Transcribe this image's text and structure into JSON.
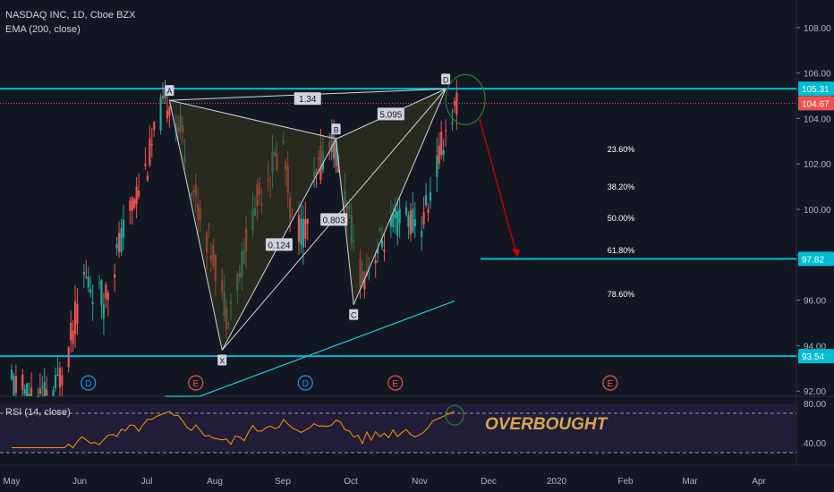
{
  "header": {
    "title": "NASDAQ INC, 1D, Cboe BZX",
    "indicator": "EMA (200, close)"
  },
  "colors": {
    "background": "#131722",
    "up": "#26a69a",
    "down": "#ef5350",
    "cyan": "#00bcd4",
    "ema": "#26c6da",
    "rsi": "#ff9800",
    "pattern_fill": "#3a3a1e",
    "arrow": "#d50000"
  },
  "chart_data": {
    "type": "candlestick",
    "title": "NASDAQ INC, 1D, Cboe BZX",
    "xlabel": "",
    "ylabel": "",
    "ylim": [
      91.5,
      108.8
    ],
    "y_ticks": [
      "108.00",
      "106.00",
      "104.00",
      "102.00",
      "100.00",
      "98.00",
      "96.00",
      "94.00",
      "92.00"
    ],
    "x_ticks": [
      "May",
      "Jun",
      "Jul",
      "Aug",
      "Sep",
      "Oct",
      "Nov",
      "Dec",
      "2020",
      "Feb",
      "Mar",
      "Apr"
    ],
    "price_labels": [
      {
        "text": "105.31",
        "value": 105.31,
        "style": "cyan"
      },
      {
        "text": "104.67",
        "value": 104.67,
        "style": "red"
      },
      {
        "text": "97.82",
        "value": 97.82,
        "style": "cyan"
      },
      {
        "text": "93.54",
        "value": 93.54,
        "style": "cyan"
      }
    ],
    "horizontal_lines": [
      105.31,
      97.82,
      93.54
    ],
    "harmonic_pattern": {
      "points": [
        {
          "label": "X",
          "date": "Aug 5",
          "price": 93.8
        },
        {
          "label": "A",
          "date": "Jul 12",
          "price": 104.8
        },
        {
          "label": "B",
          "date": "Sep 26",
          "price": 103.1
        },
        {
          "label": "C",
          "date": "Oct 4",
          "price": 95.8
        },
        {
          "label": "D",
          "date": "Nov 15",
          "price": 105.3
        }
      ],
      "ratios": [
        "1.34",
        "0.124",
        "5.095",
        "0.803"
      ]
    },
    "fib_levels": [
      "23.60%",
      "38.20%",
      "50.00%",
      "61.80%",
      "78.60%"
    ],
    "event_markers": [
      {
        "type": "D",
        "date": "Jun 5"
      },
      {
        "type": "E",
        "date": "Jul 24"
      },
      {
        "type": "D",
        "date": "Sep 12"
      },
      {
        "type": "E",
        "date": "Oct 23"
      },
      {
        "type": "E",
        "date": "Jan 29"
      }
    ],
    "rsi": {
      "label": "RSI (14, close)",
      "y_ticks": [
        "80.00",
        "40.00"
      ],
      "overbought_text": "OVERBOUGHT"
    }
  }
}
